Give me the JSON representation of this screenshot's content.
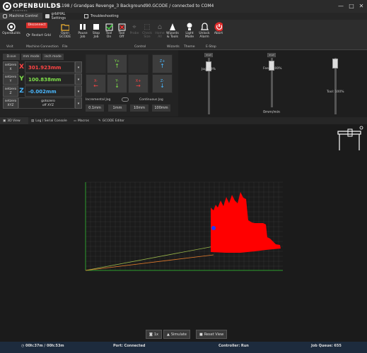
{
  "app": {
    "logo_text": "OPENBUILDS",
    "logo_sub": "CONTROL",
    "title": "v1.0.198 / Grandpas Revenge_3 Background90.GCODE / connected to COM4"
  },
  "window_controls": {
    "minimize": "—",
    "maximize": "□",
    "close": "✕"
  },
  "tabs": [
    {
      "label": "Machine Control"
    },
    {
      "label": "grblHAL Settings"
    },
    {
      "label": "Troubleshooting"
    }
  ],
  "toolbar": {
    "buttons": [
      {
        "label": "OpenBuilds",
        "icon": "openbuilds-icon"
      },
      {
        "label": "Disconnect",
        "icon": ""
      },
      {
        "label": "Restart Grbl",
        "icon": "restart-icon"
      },
      {
        "label": "Open\nGCODE",
        "icon": "folder-icon"
      },
      {
        "label": "Pause\nJob",
        "icon": "pause-icon"
      },
      {
        "label": "Stop\nJob",
        "icon": "stop-icon"
      },
      {
        "label": "Tool\nOn",
        "icon": "tool-on-icon"
      },
      {
        "label": "Tool\nOff",
        "icon": "tool-off-icon"
      },
      {
        "label": "Probe",
        "icon": "probe-icon"
      },
      {
        "label": "Check\nSize",
        "icon": "check-size-icon"
      },
      {
        "label": "Home\nAll",
        "icon": "home-icon"
      },
      {
        "label": "Wizards\n& Tools",
        "icon": "wizard-icon"
      },
      {
        "label": "Light\nMode",
        "icon": "light-mode-icon"
      },
      {
        "label": "Unlock\nAlarm",
        "icon": "bell-icon"
      },
      {
        "label": "Abort",
        "icon": "abort-icon"
      }
    ],
    "groups": [
      "Visit",
      "Machine Connection",
      "File",
      "Control",
      "Wizards",
      "Theme",
      "E-Stop"
    ]
  },
  "modes": [
    "D.ove",
    "mm mode",
    "inch mode"
  ],
  "dro": [
    {
      "setzero": "setzero\nX",
      "axis": "X",
      "value": "301.923mm",
      "color": "#ff4444"
    },
    {
      "setzero": "setzero\nY",
      "axis": "Y",
      "value": "100.838mm",
      "color": "#7fe04a"
    },
    {
      "setzero": "setzero\nZ",
      "axis": "Z",
      "value": "-0.002mm",
      "color": "#4ab8ff"
    },
    {
      "setzero": "setzero\nXYZ",
      "axis": "",
      "value": "gotozero\noff XYZ",
      "color": "#ffcc44"
    }
  ],
  "jog": {
    "y_plus": "Y+",
    "y_minus": "Y-",
    "x_plus": "X+",
    "x_minus": "X-",
    "z_plus": "Z+",
    "z_minus": "Z-",
    "incremental": "Incremental Jog",
    "continuous": "Continuous Jog",
    "steps": [
      "0.1mm",
      "1mm",
      "10mm",
      "100mm"
    ]
  },
  "sliders": {
    "reset": "reset",
    "jog_label": "Jog: 89%",
    "feed_label": "Feed: 100%",
    "feed_unit": "0mm/min",
    "tool_label": "Tool: 100%",
    "jog_percent": 89,
    "feed_percent": 100,
    "tool_percent": 100
  },
  "view_tabs": [
    "3D View",
    "Log / Serial Console",
    "Macros",
    "GCODE Editor"
  ],
  "view_buttons": {
    "camera": "1x",
    "simulate": "Simulate",
    "reset_view": "Reset View"
  },
  "status": {
    "time": "00h:37m / 00h:53m",
    "port_label": "Port:",
    "port_value": "Connected",
    "controller_label": "Controller:",
    "controller_value": "Run",
    "queue_label": "Job Queue:",
    "queue_value": "655"
  },
  "colors": {
    "accent_red": "#ff0000",
    "grid": "#3a3a3a",
    "axis_green": "#2d9c2d",
    "status_bar": "#1d2b3d"
  }
}
